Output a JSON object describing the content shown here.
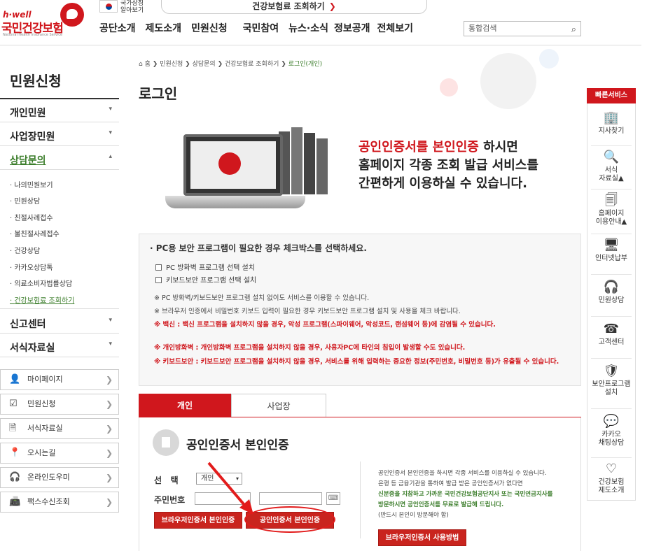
{
  "header": {
    "logo_en": "h·well",
    "logo_kr": "국민건강보험",
    "logo_sub": "National Health Insurance Service",
    "flag_text_1": "국가상징",
    "flag_text_2": "알아보기",
    "lookup_banner": "건강보험료 조회하기",
    "lookup_arrow": "❯",
    "gnb": [
      "공단소개",
      "제도소개",
      "민원신청",
      "국민참여",
      "뉴스·소식",
      "정보공개",
      "전체보기"
    ],
    "search_placeholder": "통합검색",
    "search_icon": "⌕"
  },
  "sidebar": {
    "title": "민원신청",
    "menus": [
      {
        "label": "개인민원",
        "caret": "▾"
      },
      {
        "label": "사업장민원",
        "caret": "▾"
      },
      {
        "label": "상담문의",
        "caret": "▴"
      }
    ],
    "sub_items": [
      "나의민원보기",
      "민원상담",
      "친절사례접수",
      "불친절사례접수",
      "건강상담",
      "카카오상담톡",
      "의료소비자법률상담",
      "건강보험료 조회하기"
    ],
    "menus_bottom": [
      {
        "label": "신고센터",
        "caret": "▾"
      },
      {
        "label": "서식자료실",
        "caret": "▾"
      }
    ],
    "quick_links": [
      {
        "icon": "user-icon",
        "glyph": "👤",
        "label": "마이페이지"
      },
      {
        "icon": "checkbox-icon",
        "glyph": "☑",
        "label": "민원신청"
      },
      {
        "icon": "document-icon",
        "glyph": "🗎",
        "label": "서식자료실"
      },
      {
        "icon": "location-icon",
        "glyph": "📍",
        "label": "오시는길"
      },
      {
        "icon": "headset-icon",
        "glyph": "🎧",
        "label": "온라인도우미"
      },
      {
        "icon": "fax-icon",
        "glyph": "📠",
        "label": "팩스수신조회"
      }
    ],
    "quick_arrow": "❯"
  },
  "breadcrumb": {
    "home": "홈",
    "sep": "❯",
    "items": [
      "민원신청",
      "상담문의",
      "건강보험료 조회하기"
    ],
    "current": "로그인(개인)"
  },
  "page_title": "로그인",
  "hero": {
    "line1_red": "공인인증서를 본인인증",
    "line1_rest": " 하시면",
    "line2": "홈페이지 각종 조회 발급 서비스를",
    "line3": "간편하게 이용하실 수 있습니다."
  },
  "security": {
    "heading": "· PC용 보안 프로그램이 필요한 경우 체크박스를 선택하세요.",
    "options": [
      "PC 방화벽 프로그램 선택 설치",
      "키보드보안 프로그램 선택 설치"
    ],
    "notes": [
      "※ PC 방화벽/키보드보안 프로그램 설치 없이도 서비스를 이용할 수 있습니다.",
      "※ 브라우저 인증에서 비밀번호 키보드 입력이 필요한 경우 키보드보안 프로그램 설치 및 사용을 체크 바랍니다."
    ],
    "warnings": [
      "※ 백신 : 백신 프로그램을 설치하지 않을 경우, 악성 프로그램(스파이웨어, 악성코드, 랜섬웨어 등)에 감염될 수 있습니다.",
      "※ 개인방화벽 : 개인방화벽 프로그램을 설치하지 않을 경우, 사용자PC에 타인의 침입이 발생할 수도 있습니다.",
      "※ 키보드보안 : 키보드보안 프로그램을 설치하지 않을 경우, 서비스를 위해 입력하는 중요한 정보(주민번호, 비밀번호 등)가 유출될 수 있습니다."
    ]
  },
  "tabs": [
    "개인",
    "사업장"
  ],
  "login": {
    "title": "공인인증서 본인인증",
    "select_label": "선   택",
    "select_value": "개인",
    "select_caret": "▾",
    "id_label": "주민번호",
    "keyboard_icon": "⌨",
    "btn_browser": "브라우저인증서 본인인증",
    "btn_cert": "공인인증서 본인인증",
    "info": [
      "공인인증서 본인인증을 하시면 각종 서비스를 이용하실 수 있습니다.",
      "은행 등 금융기관을 통하여 발급 받은 공인인증서가 없다면"
    ],
    "info_green": [
      "신분증을 지참하고 가까운 국민건강보험공단지사 또는 국민연금지사를",
      "방문하시면 공인인증서를 무료로 발급해 드립니다."
    ],
    "info_note": "(반드시 본인이 방문해야 함)",
    "btn_howto": "브라우저인증서 사용방법"
  },
  "quick_service": {
    "title": "빠른서비스",
    "items": [
      {
        "icon": "building-icon",
        "glyph": "🏢",
        "label": "지사찾기"
      },
      {
        "icon": "search-document-icon",
        "glyph": "🔍",
        "label": "서식\n자료실▲"
      },
      {
        "icon": "pages-icon",
        "glyph": "🗐",
        "label": "홈페이지\n이용안내▲"
      },
      {
        "icon": "e-monitor-icon",
        "glyph": "🖥",
        "label": "인터넷납부"
      },
      {
        "icon": "headset-icon",
        "glyph": "🎧",
        "label": "민원상담"
      },
      {
        "icon": "phone-icon",
        "glyph": "☎",
        "label": "고객센터"
      },
      {
        "icon": "shield-icon",
        "glyph": "🛡",
        "label": "보안프로그램\n설치"
      },
      {
        "icon": "talk-icon",
        "glyph": "💬",
        "label": "카카오\n채팅상담"
      },
      {
        "icon": "heart-pulse-icon",
        "glyph": "♡",
        "label": "건강보험\n제도소개"
      }
    ]
  },
  "colors": {
    "brand_red": "#d0171d",
    "active_green": "#3b7d2a",
    "annotation_red": "#e21b1b"
  }
}
